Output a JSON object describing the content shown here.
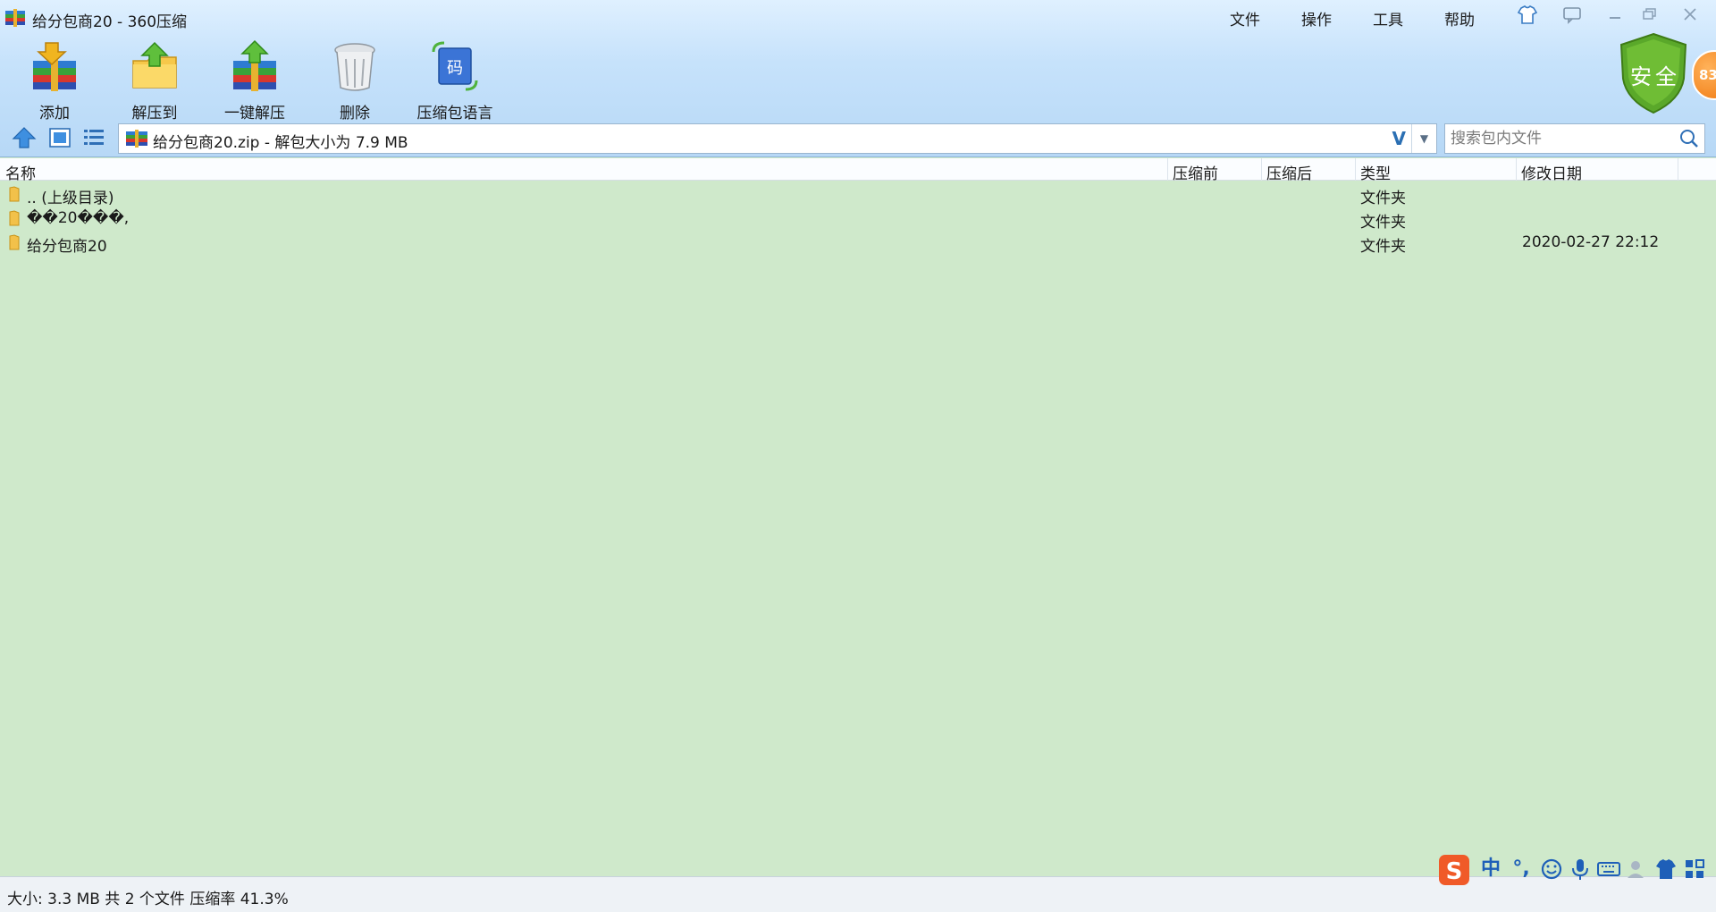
{
  "window": {
    "title": "给分包商20 - 360压缩"
  },
  "menu": {
    "file": "文件",
    "operate": "操作",
    "tools": "工具",
    "help": "帮助"
  },
  "toolbar": {
    "add": "添加",
    "extract_to": "解压到",
    "one_click_extract": "一键解压",
    "delete": "删除",
    "archive_language": "压缩包语言"
  },
  "security": {
    "label": "安全",
    "score": "83"
  },
  "path": {
    "text": "给分包商20.zip - 解包大小为 7.9 MB",
    "v_label": "V"
  },
  "search": {
    "placeholder": "搜索包内文件"
  },
  "columns": {
    "name": "名称",
    "before": "压缩前",
    "after": "压缩后",
    "type": "类型",
    "modified": "修改日期"
  },
  "rows": [
    {
      "name": ".. (上级目录)",
      "type": "文件夹",
      "modified": ""
    },
    {
      "name": "��20���,",
      "type": "文件夹",
      "modified": ""
    },
    {
      "name": "给分包商20",
      "type": "文件夹",
      "modified": "2020-02-27 22:12"
    }
  ],
  "status": {
    "text": "大小: 3.3 MB 共 2 个文件 压缩率 41.3%"
  },
  "ime": {
    "mode": "中",
    "punct": "°,"
  },
  "colors": {
    "list_bg": "#cfe9cb",
    "toolbar_bg": "#c6e2fb",
    "accent": "#2b6fb3"
  }
}
